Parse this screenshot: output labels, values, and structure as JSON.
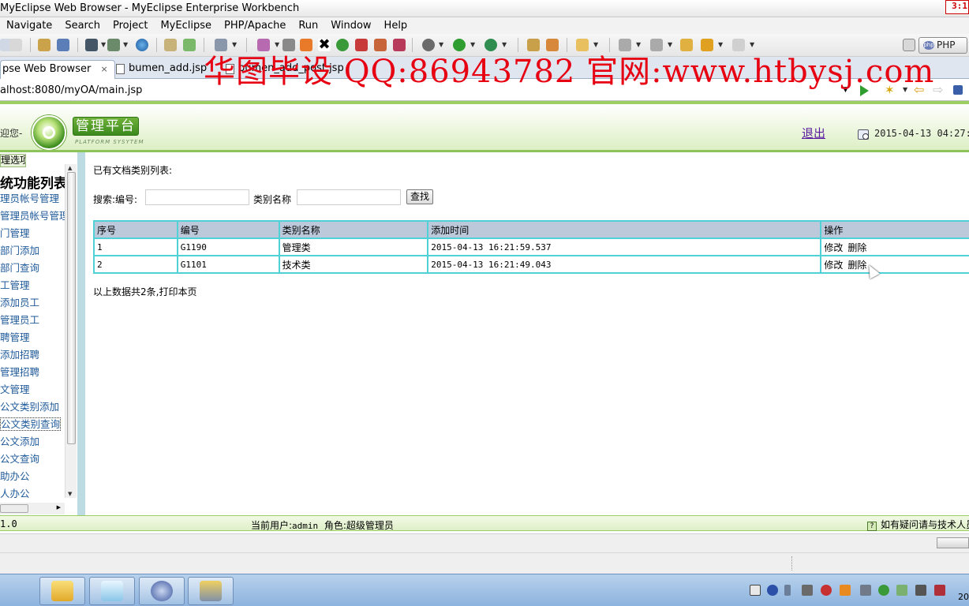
{
  "window": {
    "title": "MyEclipse Web Browser - MyEclipse Enterprise Workbench",
    "clock_fragment": "3:1"
  },
  "menu": [
    "Navigate",
    "Search",
    "Project",
    "MyEclipse",
    "PHP/Apache",
    "Run",
    "Window",
    "Help"
  ],
  "toolbar": {
    "php_label": "PHP"
  },
  "tabs": [
    {
      "label": "pse Web Browser",
      "close": "×"
    },
    {
      "label": "bumen_add.jsp"
    },
    {
      "label": "bumen_add_post.jsp"
    }
  ],
  "watermark": "华图毕设 QQ:86943782 官网:www.htbysj.com",
  "address": {
    "url": "alhost:8080/myOA/main.jsp"
  },
  "app": {
    "greeting": "迎您-",
    "platform_title": "管理平台",
    "platform_subtitle": "PLATFORM SYSYTEM",
    "logout": "退出",
    "datetime": "2015-04-13 04:27:"
  },
  "sidebar": {
    "options_button": "理选项",
    "menu_title": "统功能列表",
    "items": [
      "理员帐号管理",
      "管理员帐号管理",
      "门管理",
      "部门添加",
      "部门查询",
      "工管理",
      "添加员工",
      "管理员工",
      "聘管理",
      "添加招聘",
      "管理招聘",
      "文管理",
      "公文类别添加",
      "公文类别查询",
      "公文添加",
      "公文查询",
      "助办公",
      "人办公"
    ],
    "active_index": 13
  },
  "main": {
    "list_title": "已有文档类别列表:",
    "search_label": "搜索:编号:",
    "category_label": "类别名称",
    "search_value": "",
    "category_value": "",
    "search_button": "查找",
    "table": {
      "headers": [
        "序号",
        "编号",
        "类别名称",
        "添加时间",
        "操作"
      ],
      "rows": [
        {
          "index": "1",
          "code": "G1190",
          "name": "管理类",
          "time": "2015-04-13 16:21:59.537",
          "edit": "修改",
          "delete": "删除"
        },
        {
          "index": "2",
          "code": "G1101",
          "name": "技术类",
          "time": "2015-04-13 16:21:49.043",
          "edit": "修改",
          "delete": "删除"
        }
      ]
    },
    "summary": "以上数据共2条,打印本页"
  },
  "footer": {
    "version": "1.0",
    "user_prefix": "当前用户:",
    "user": "admin",
    "role": "角色:超级管理员",
    "help": "如有疑问请与技术人员"
  },
  "taskbar": {
    "time_fragment": "20"
  },
  "colors": {
    "header_green": "#9ccf62",
    "table_border": "#4fd1d6",
    "table_header_bg": "#bcc9db",
    "sidebar_link": "#1f5a9a",
    "watermark": "#e60012"
  }
}
